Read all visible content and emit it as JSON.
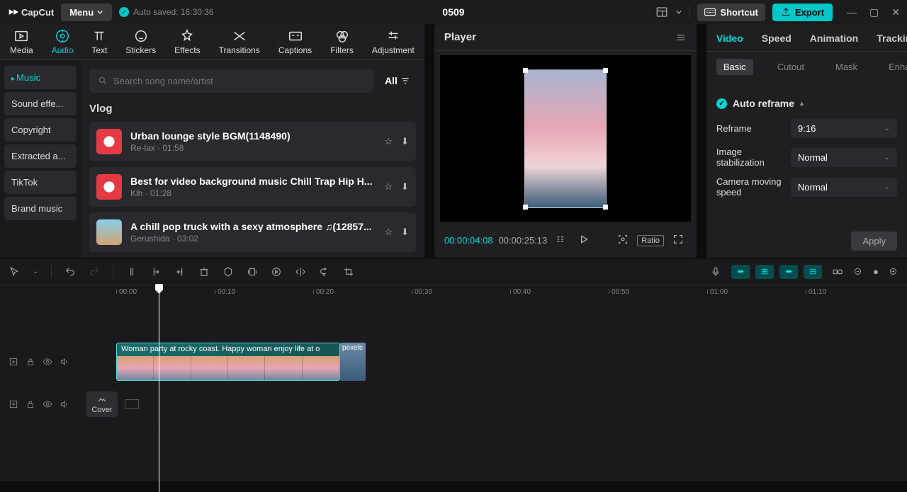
{
  "titlebar": {
    "app": "CapCut",
    "menu": "Menu",
    "autosave": "Auto saved: 16:30:36",
    "project": "0509",
    "shortcut": "Shortcut",
    "export": "Export"
  },
  "top_tabs": [
    "Media",
    "Audio",
    "Text",
    "Stickers",
    "Effects",
    "Transitions",
    "Captions",
    "Filters",
    "Adjustment"
  ],
  "top_tabs_active": 1,
  "categories": [
    "Music",
    "Sound effe...",
    "Copyright",
    "Extracted a...",
    "TikTok",
    "Brand music"
  ],
  "categories_active": 0,
  "search": {
    "placeholder": "Search song name/artist",
    "filter": "All"
  },
  "section": "Vlog",
  "songs": [
    {
      "title": "Urban lounge style BGM(1148490)",
      "artist": "Re-lax",
      "dur": "01:58",
      "thumb": "red"
    },
    {
      "title": "Best for video background music Chill Trap Hip H...",
      "artist": "Klh",
      "dur": "01:28",
      "thumb": "red"
    },
    {
      "title": "A chill pop truck with a sexy atmosphere ♫(12857...",
      "artist": "Gerushida",
      "dur": "03:02",
      "thumb": "sky"
    }
  ],
  "player": {
    "title": "Player",
    "current": "00:00:04:08",
    "total": "00:00:25:13",
    "ratio": "Ratio"
  },
  "right": {
    "tabs": [
      "Video",
      "Speed",
      "Animation",
      "Tracking"
    ],
    "tabs_active": 0,
    "subtabs": [
      "Basic",
      "Cutout",
      "Mask",
      "Enhance"
    ],
    "subtabs_active": 0,
    "auto_reframe": "Auto reframe",
    "reframe_label": "Reframe",
    "reframe_value": "9:16",
    "stabilization_label": "Image stabilization",
    "stabilization_value": "Normal",
    "camera_label": "Camera moving speed",
    "camera_value": "Normal",
    "apply": "Apply"
  },
  "timeline": {
    "marks": [
      "00:00",
      "00:10",
      "00:20",
      "00:30",
      "00:40",
      "00:50",
      "01:00",
      "01:10"
    ],
    "clip1_text": "Woman party at rocky coast. Happy woman enjoy life at o",
    "clip2_text": "pexels",
    "cover": "Cover"
  }
}
